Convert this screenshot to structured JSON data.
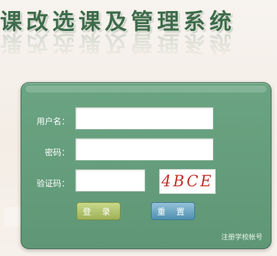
{
  "header": {
    "title": "课改选课及管理系统"
  },
  "login": {
    "username_label": "用户名：",
    "password_label": "密码：",
    "captcha_label": "验证码：",
    "captcha_text": "4BCE",
    "login_button": "登 录",
    "reset_button": "重 置",
    "register_link": "注册学校帐号"
  },
  "colors": {
    "panel": "#6ba482",
    "title": "#3e6b4a",
    "captcha_text": "#c0312b",
    "login_button": "#b4c56f",
    "reset_button": "#6fa6c2"
  }
}
